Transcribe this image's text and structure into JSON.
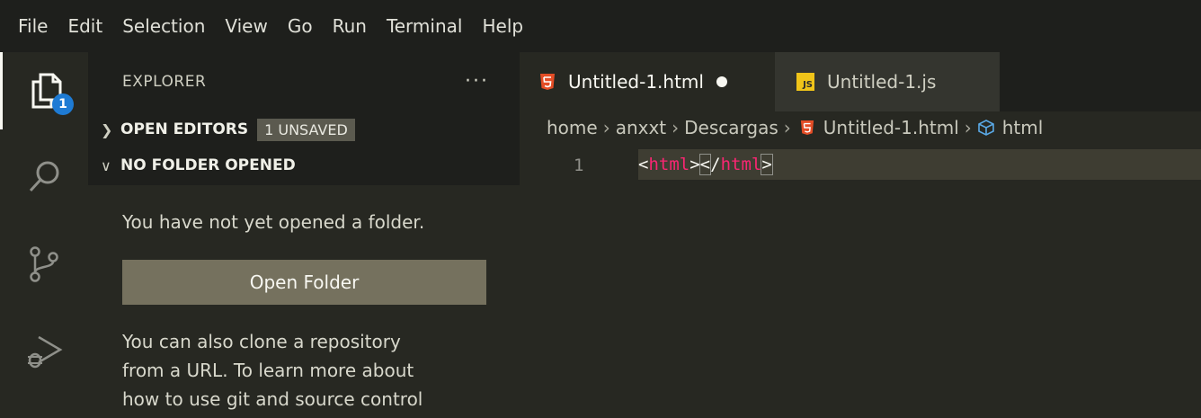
{
  "menubar": {
    "items": [
      "File",
      "Edit",
      "Selection",
      "View",
      "Go",
      "Run",
      "Terminal",
      "Help"
    ]
  },
  "activitybar": {
    "explorer_badge": "1",
    "icons": [
      "files-icon",
      "search-icon",
      "source-control-icon",
      "run-debug-icon"
    ]
  },
  "sidebar": {
    "title": "EXPLORER",
    "more": "···",
    "open_editors": {
      "label": "OPEN EDITORS",
      "badge": "1 UNSAVED"
    },
    "no_folder": {
      "label": "NO FOLDER OPENED"
    },
    "message": "You have not yet opened a folder.",
    "open_folder_button": "Open Folder",
    "clone_line1": "You can also clone a repository",
    "clone_line2": "from a URL. To learn more about",
    "clone_line3": "how to use git and source control"
  },
  "tabs": [
    {
      "label": "Untitled-1.html",
      "icon": "html5-icon",
      "dirty": true
    },
    {
      "label": "Untitled-1.js",
      "icon": "js-icon",
      "dirty": false
    }
  ],
  "breadcrumb": {
    "parts": [
      "home",
      "anxxt",
      "Descargas",
      "Untitled-1.html",
      "html"
    ]
  },
  "editor": {
    "line_number": "1",
    "code": {
      "open_lt": "<",
      "open_tag": "html",
      "open_gt": ">",
      "close_lt": "<",
      "close_slash": "/",
      "close_tag": "html",
      "close_gt": ">"
    }
  },
  "colors": {
    "accent_badge": "#1e7bd4",
    "html_icon": "#e44d26",
    "js_icon": "#f0c419",
    "tag": "#f92672"
  }
}
